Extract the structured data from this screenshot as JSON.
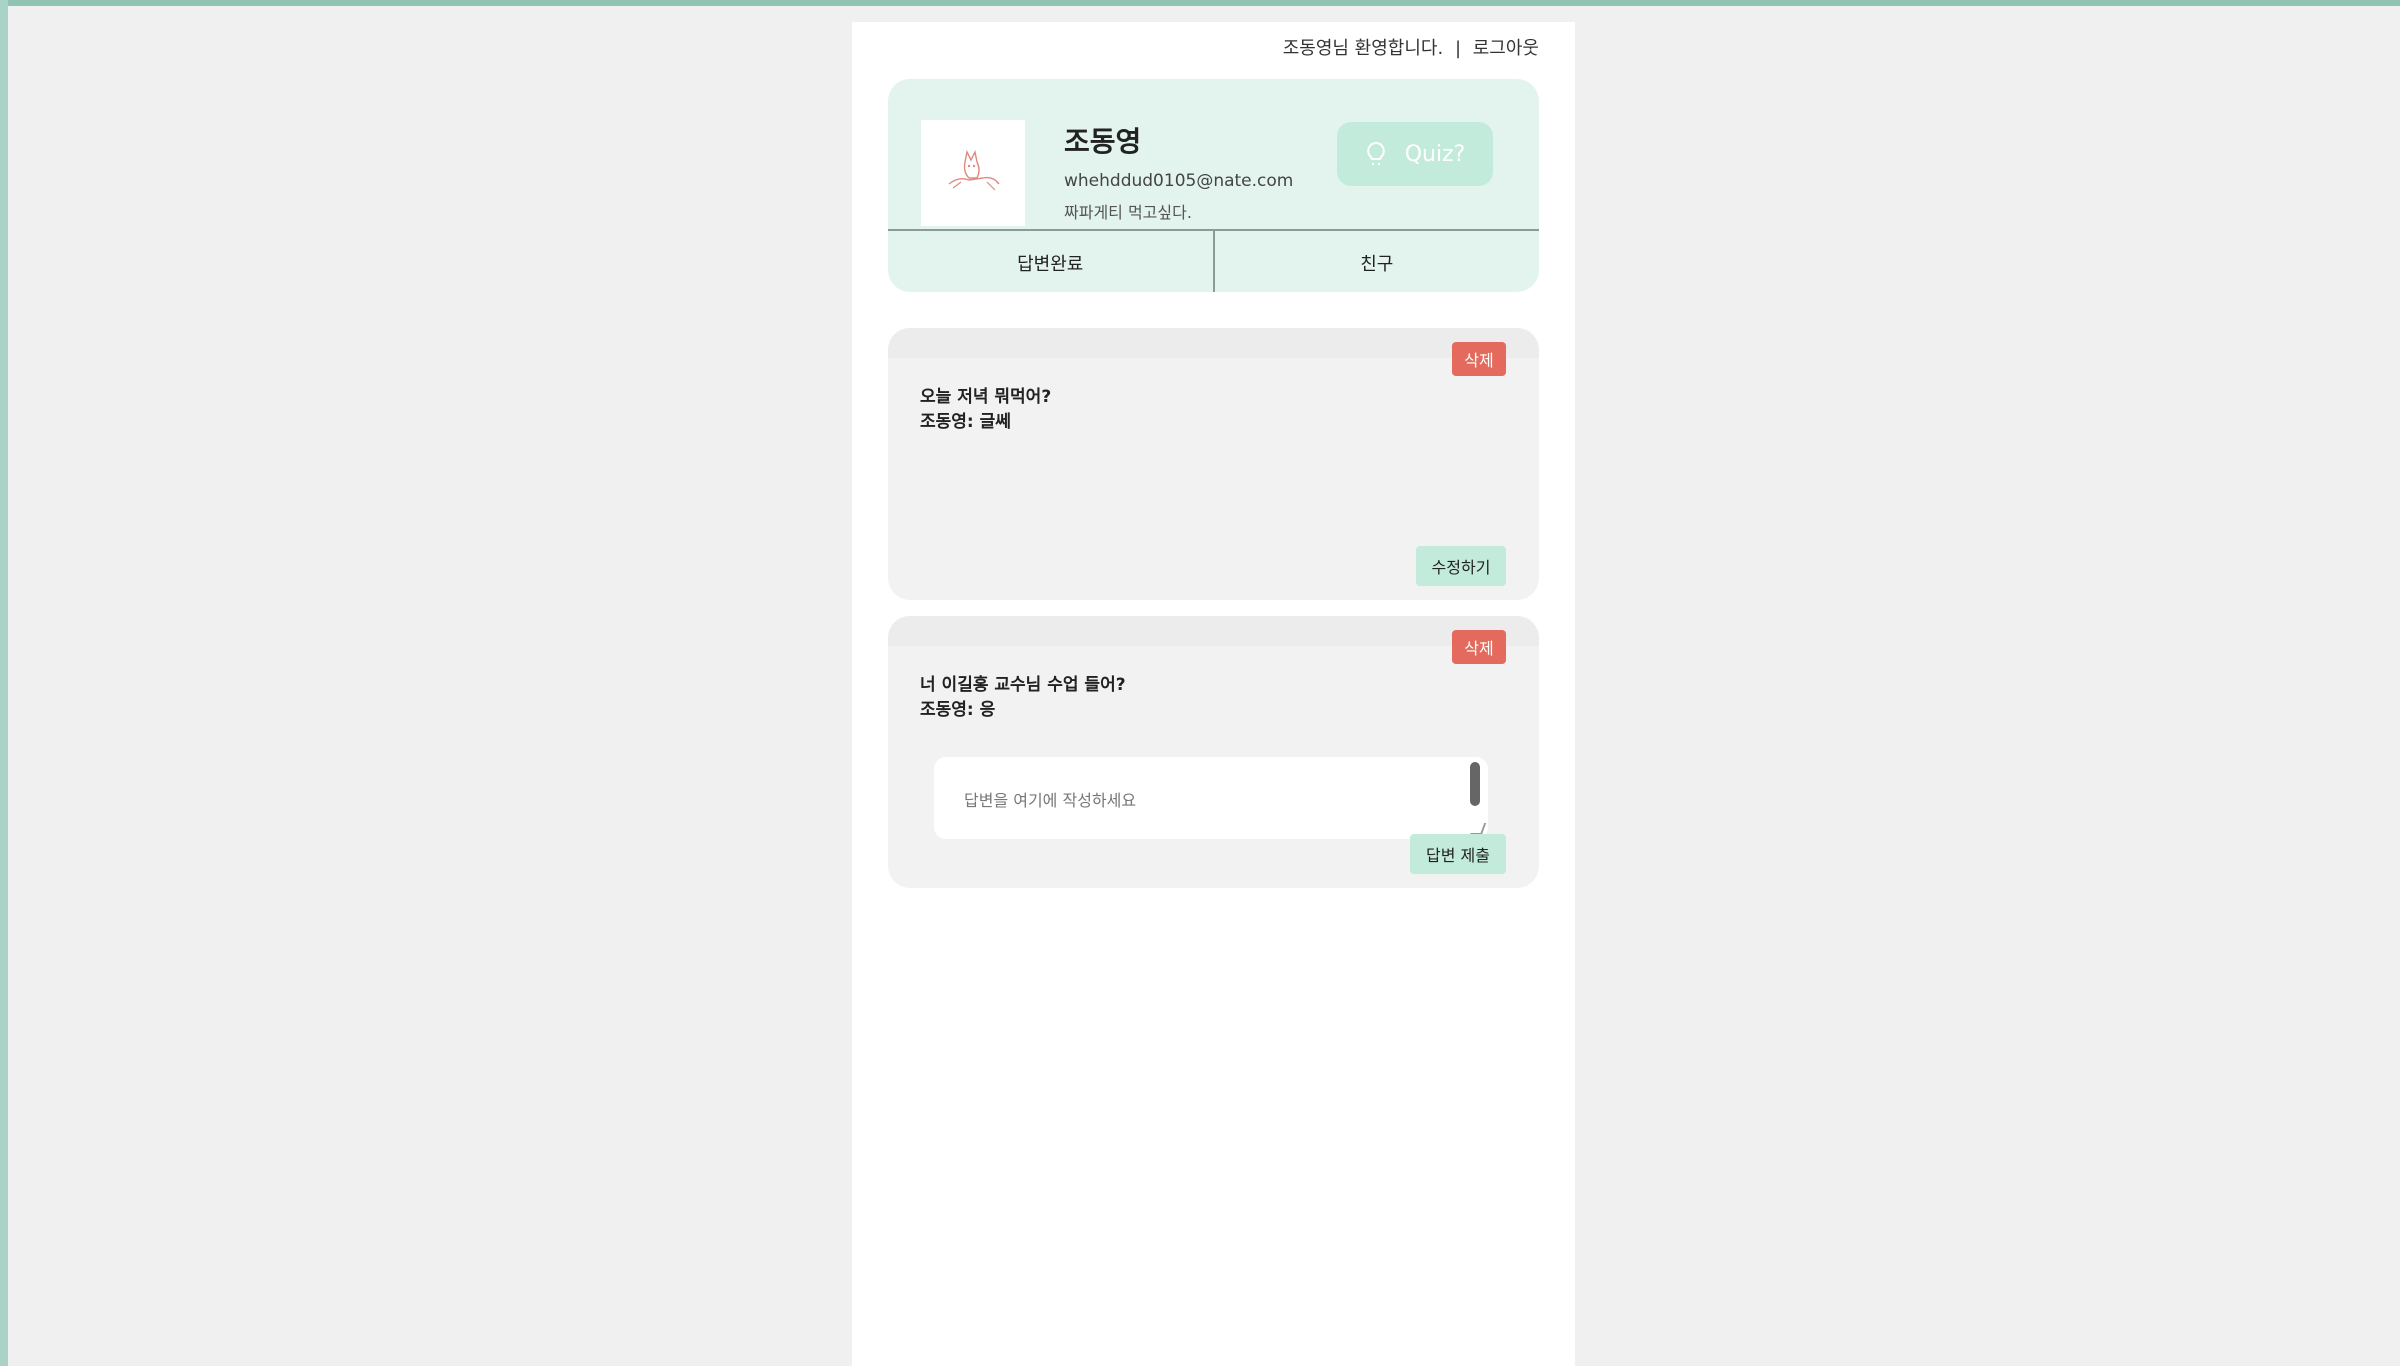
{
  "header": {
    "greeting": "조동영님 환영합니다.",
    "separator": "|",
    "logout": "로그아웃"
  },
  "profile": {
    "name": "조동영",
    "email": "whehddud0105@nate.com",
    "status": "짜파게티 먹고싶다.",
    "quiz_label": "Quiz?",
    "avatar_icon": "doodle-avatar",
    "quiz_icon": "lightbulb-icon"
  },
  "tabs": [
    {
      "label": "답변완료"
    },
    {
      "label": "친구"
    }
  ],
  "cards": [
    {
      "delete_label": "삭제",
      "question": "오늘 저녁 뭐먹어?",
      "answer": "조동영: 글쎄",
      "edit_label": "수정하기"
    },
    {
      "delete_label": "삭제",
      "question": "너 이길홍 교수님 수업 들어?",
      "answer": "조동영: 응",
      "answer_placeholder": "답변을 여기에 작성하세요",
      "submit_label": "답변 제출"
    }
  ],
  "colors": {
    "accent": "#c3ebdc",
    "card_bg": "#e3f4ee",
    "danger": "#e36a5c",
    "page_bg": "#f0f0f0"
  }
}
